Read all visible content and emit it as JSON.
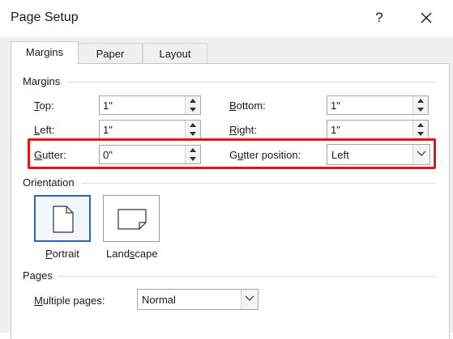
{
  "dialog": {
    "title": "Page Setup",
    "help": "?"
  },
  "tabs": [
    {
      "label": "Margins"
    },
    {
      "label": "Paper"
    },
    {
      "label": "Layout"
    }
  ],
  "margins": {
    "section_label": "Margins",
    "top": {
      "accel": "T",
      "rest": "op:",
      "value": "1\""
    },
    "bottom": {
      "accel": "B",
      "rest": "ottom:",
      "value": "1\""
    },
    "left": {
      "accel": "L",
      "rest": "eft:",
      "value": "1\""
    },
    "right": {
      "accel": "R",
      "rest": "ight:",
      "value": "1\""
    },
    "gutter": {
      "accel": "G",
      "rest": "utter:",
      "value": "0\""
    },
    "gutter_position": {
      "pre": "G",
      "accel": "u",
      "rest": "tter position:",
      "value": "Left"
    }
  },
  "orientation": {
    "section_label": "Orientation",
    "portrait": {
      "accel": "P",
      "rest": "ortrait"
    },
    "landscape": {
      "pre": "Land",
      "accel": "s",
      "rest": "cape"
    }
  },
  "pages": {
    "section_label": "Pages",
    "multiple_pages": {
      "accel": "M",
      "rest": "ultiple pages:",
      "value": "Normal"
    }
  },
  "colors": {
    "highlight": "#e1161a",
    "selected_border": "#2b66b6"
  }
}
